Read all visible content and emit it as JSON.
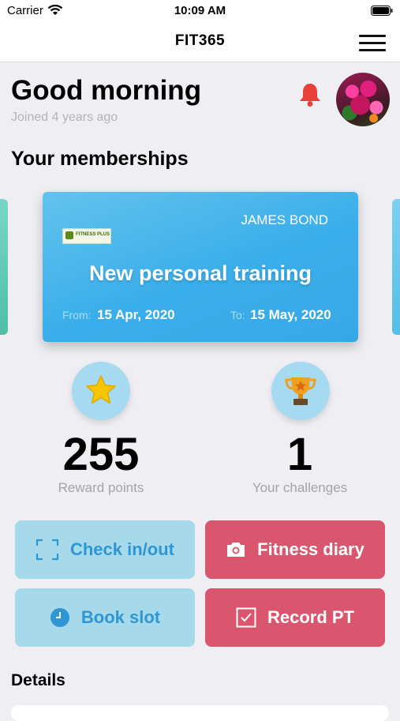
{
  "status_bar": {
    "carrier": "Carrier",
    "time": "10:09 AM"
  },
  "nav": {
    "title": "FIT365"
  },
  "header": {
    "greeting": "Good morning",
    "joined": "Joined 4 years ago"
  },
  "memberships": {
    "title": "Your memberships",
    "card": {
      "name": "JAMES BOND",
      "logo_text": "FITNESS PLUS",
      "title": "New personal training",
      "from_label": "From:",
      "from_date": "15 Apr, 2020",
      "to_label": "To:",
      "to_date": "15 May, 2020"
    }
  },
  "stats": {
    "reward": {
      "value": "255",
      "label": "Reward points",
      "icon": "star-icon"
    },
    "challenges": {
      "value": "1",
      "label": "Your challenges",
      "icon": "trophy-icon"
    }
  },
  "actions": {
    "check_in": "Check in/out",
    "fitness_diary": "Fitness diary",
    "book_slot": "Book slot",
    "record_pt": "Record PT"
  },
  "details": {
    "title": "Details"
  },
  "colors": {
    "accent_blue": "#3aaeea",
    "button_blue": "#a6daea",
    "button_red": "#d9566e",
    "bell_red": "#e8413a"
  }
}
